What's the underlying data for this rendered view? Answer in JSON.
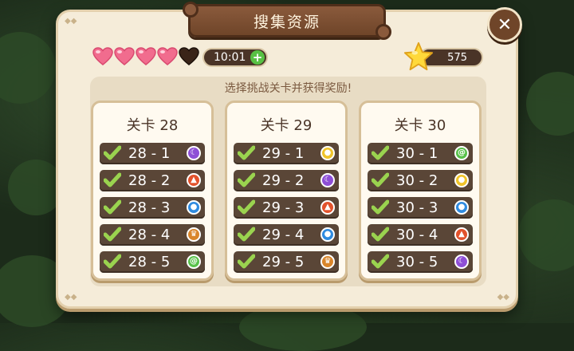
{
  "header": {
    "title": "搜集资源"
  },
  "close_button": {
    "label": "✕"
  },
  "lives": {
    "hearts": [
      {
        "state": "full",
        "color": "#f16c8e"
      },
      {
        "state": "full",
        "color": "#f16c8e"
      },
      {
        "state": "full",
        "color": "#f16c8e"
      },
      {
        "state": "full",
        "color": "#f16c8e"
      },
      {
        "state": "empty",
        "color": "#3a2418"
      }
    ],
    "timer": "10:01",
    "plus_label": "+"
  },
  "stars": {
    "count": "575"
  },
  "main": {
    "subtitle": "选择挑战关卡并获得奖励!"
  },
  "stages": [
    {
      "title": "关卡 28",
      "levels": [
        {
          "label": "28 - 1",
          "completed": true,
          "resource": "moon-icon"
        },
        {
          "label": "28 - 2",
          "completed": true,
          "resource": "fire-icon"
        },
        {
          "label": "28 - 3",
          "completed": true,
          "resource": "water-drop-icon"
        },
        {
          "label": "28 - 4",
          "completed": true,
          "resource": "crown-icon"
        },
        {
          "label": "28 - 5",
          "completed": true,
          "resource": "swirl-icon"
        }
      ]
    },
    {
      "title": "关卡 29",
      "levels": [
        {
          "label": "29 - 1",
          "completed": true,
          "resource": "sun-icon"
        },
        {
          "label": "29 - 2",
          "completed": true,
          "resource": "moon-icon"
        },
        {
          "label": "29 - 3",
          "completed": true,
          "resource": "fire-icon"
        },
        {
          "label": "29 - 4",
          "completed": true,
          "resource": "water-drop-icon"
        },
        {
          "label": "29 - 5",
          "completed": true,
          "resource": "crown-icon"
        }
      ]
    },
    {
      "title": "关卡 30",
      "levels": [
        {
          "label": "30 - 1",
          "completed": true,
          "resource": "swirl-icon"
        },
        {
          "label": "30 - 2",
          "completed": true,
          "resource": "sun-icon"
        },
        {
          "label": "30 - 3",
          "completed": true,
          "resource": "water-drop-icon"
        },
        {
          "label": "30 - 4",
          "completed": true,
          "resource": "fire-icon"
        },
        {
          "label": "30 - 5",
          "completed": true,
          "resource": "moon-icon"
        }
      ]
    }
  ]
}
